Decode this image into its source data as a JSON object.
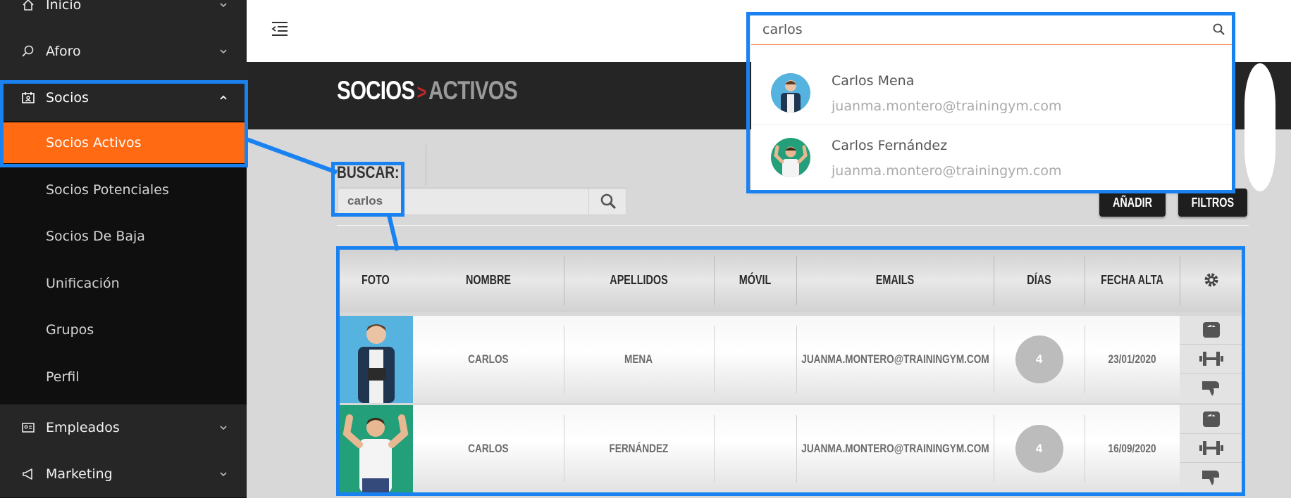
{
  "sidebar": {
    "items": [
      {
        "label": "Inicio",
        "icon": "home-icon"
      },
      {
        "label": "Aforo",
        "icon": "search-icon"
      },
      {
        "label": "Socios",
        "icon": "id-card-icon"
      },
      {
        "label": "Empleados",
        "icon": "id-card-icon"
      },
      {
        "label": "Marketing",
        "icon": "megaphone-icon"
      }
    ],
    "socios_sub": [
      {
        "label": "Socios Activos",
        "active": true
      },
      {
        "label": "Socios Potenciales"
      },
      {
        "label": "Socios De Baja"
      },
      {
        "label": "Unificación"
      },
      {
        "label": "Grupos"
      },
      {
        "label": "Perfil"
      }
    ]
  },
  "header": {
    "title_main": "SOCIOS",
    "title_arrow": ">",
    "title_sub": "ACTIVOS"
  },
  "search": {
    "label": "BUSCAR:",
    "value": "carlos"
  },
  "buttons": {
    "add": "AÑADIR",
    "filters": "FILTROS"
  },
  "table": {
    "columns": [
      "FOTO",
      "NOMBRE",
      "APELLIDOS",
      "MÓVIL",
      "EMAILS",
      "DÍAS",
      "FECHA ALTA"
    ],
    "rows": [
      {
        "nombre": "CARLOS",
        "apellidos": "MENA",
        "movil": "",
        "email": "JUANMA.MONTERO@TRAININGYM.COM",
        "dias": "4",
        "fecha": "23/01/2020"
      },
      {
        "nombre": "CARLOS",
        "apellidos": "FERNÁNDEZ",
        "movil": "",
        "email": "JUANMA.MONTERO@TRAININGYM.COM",
        "dias": "4",
        "fecha": "16/09/2020"
      }
    ]
  },
  "dropdown": {
    "query": "carlos",
    "results": [
      {
        "name": "Carlos Mena",
        "email": "juanma.montero@trainingym.com"
      },
      {
        "name": "Carlos Fernández",
        "email": "juanma.montero@trainingym.com"
      }
    ]
  },
  "colors": {
    "accent": "#ff6a13",
    "highlight": "#1a82f0",
    "sidebar_bg": "#0f0f0f",
    "title_band": "#252525"
  }
}
